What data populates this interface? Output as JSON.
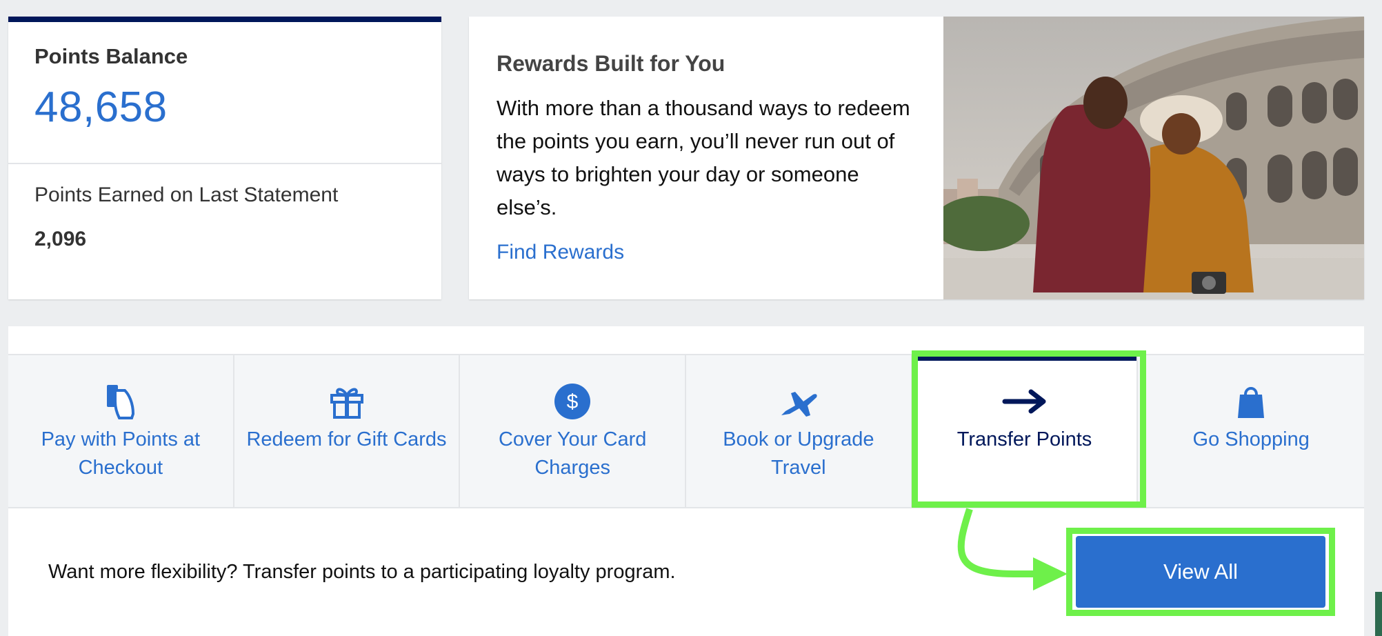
{
  "balance": {
    "label": "Points Balance",
    "value": "48,658",
    "earned_label": "Points Earned on Last Statement",
    "earned_value": "2,096"
  },
  "promo": {
    "title": "Rewards Built for You",
    "body": "With more than a thousand ways to redeem the points you earn, you’ll never run out of ways to brighten your day or someone else’s.",
    "link": "Find Rewards"
  },
  "tabs": [
    {
      "label": "Pay with Points at Checkout",
      "icon": "card-tap-icon"
    },
    {
      "label": "Redeem for Gift Cards",
      "icon": "gift-icon"
    },
    {
      "label": "Cover Your Card Charges",
      "icon": "dollar-circle-icon"
    },
    {
      "label": "Book or Upgrade Travel",
      "icon": "airplane-icon"
    },
    {
      "label": "Transfer Points",
      "icon": "arrow-right-icon",
      "active": true
    },
    {
      "label": "Go Shopping",
      "icon": "shopping-bag-icon"
    }
  ],
  "transfer": {
    "description": "Want more flexibility? Transfer points to a participating loyalty program.",
    "button": "View All"
  },
  "colors": {
    "accent": "#2a6fce",
    "navy": "#00175a",
    "highlight": "#6ef04a"
  }
}
